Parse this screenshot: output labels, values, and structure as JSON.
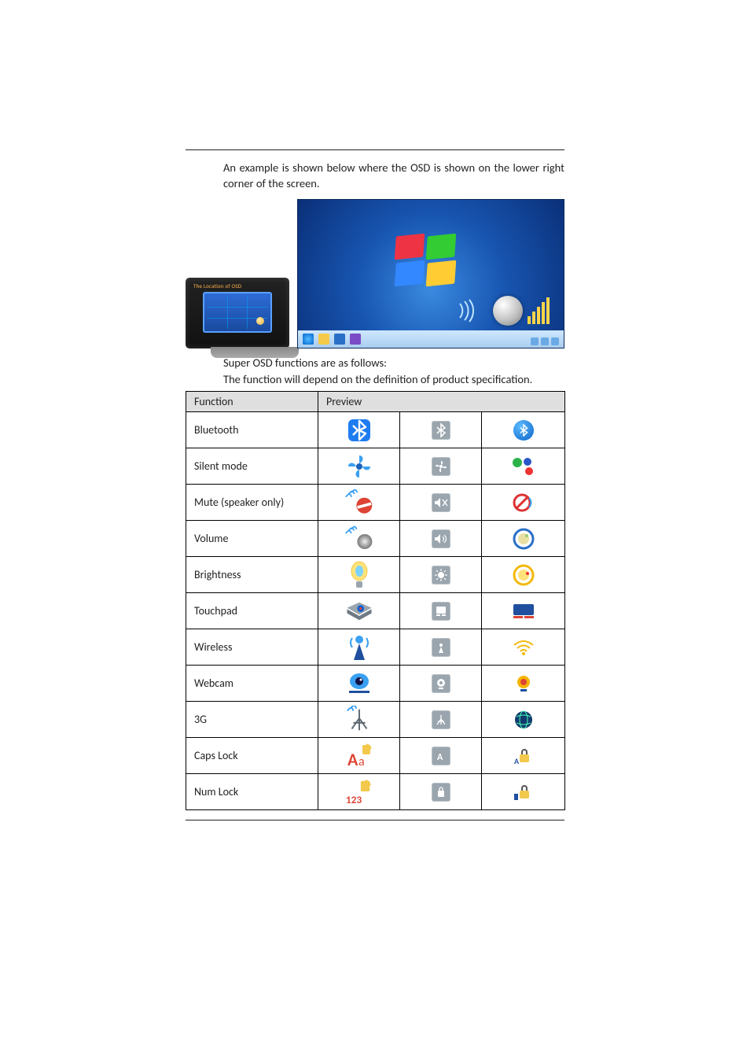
{
  "intro": "An example is shown below where the OSD is shown on the lower right corner of the screen.",
  "osd_location_caption": "The Location of OSD",
  "line1": "Super OSD functions are as follows:",
  "line2": "The function will depend on the definition of product specification.",
  "headers": {
    "function": "Function",
    "preview": "Preview"
  },
  "rows": [
    {
      "fn": "Bluetooth"
    },
    {
      "fn": "Silent mode"
    },
    {
      "fn": "Mute (speaker only)"
    },
    {
      "fn": "Volume"
    },
    {
      "fn": "Brightness"
    },
    {
      "fn": "Touchpad"
    },
    {
      "fn": "Wireless"
    },
    {
      "fn": "Webcam"
    },
    {
      "fn": "3G"
    },
    {
      "fn": "Caps Lock"
    },
    {
      "fn": "Num Lock"
    }
  ]
}
